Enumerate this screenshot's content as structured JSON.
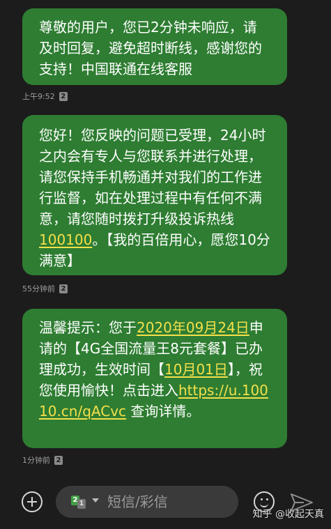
{
  "messages": [
    {
      "parts": [
        {
          "text": "尊敬的用户，您已2分钟未响应，请及时回复，避免超时断线，感谢您的支持！中国联通在线客服",
          "link": false
        }
      ],
      "time": "上午9:52",
      "sim": "2"
    },
    {
      "parts": [
        {
          "text": "您好！您反映的问题已受理，24小时之内会有专人与您联系并进行处理，请您保持手机畅通并对我们的工作进行监督，如在处理过程中有任何不满意，请您随时拨打升级投诉热线",
          "link": false
        },
        {
          "text": "100100",
          "link": true
        },
        {
          "text": "。【我的百倍用心，愿您10分满意】",
          "link": false
        }
      ],
      "time": "55分钟前",
      "sim": "2"
    },
    {
      "parts": [
        {
          "text": "温馨提示：您于",
          "link": false
        },
        {
          "text": "2020年09月24日",
          "link": true
        },
        {
          "text": "申请的【4G全国流量王8元套餐】已办理成功，生效时间【",
          "link": false
        },
        {
          "text": "10月01日",
          "link": true
        },
        {
          "text": "】，祝您使用愉快！点击进入",
          "link": false
        },
        {
          "text": "https://u.10010.cn/qACvc",
          "link": true
        },
        {
          "text": " 查询详情。",
          "link": false
        }
      ],
      "time": "1分钟前",
      "sim": "2"
    }
  ],
  "composer": {
    "placeholder": "短信/彩信",
    "sim_primary": "2",
    "sim_secondary": "1"
  },
  "watermark": "知乎 @收起天真",
  "colors": {
    "bubble": "#2e7d32",
    "link": "#f5e04a",
    "background": "#1c1c1c"
  },
  "icons": [
    "add-icon",
    "sim-card-icon",
    "chevron-down-icon",
    "emoji-icon",
    "send-icon"
  ]
}
